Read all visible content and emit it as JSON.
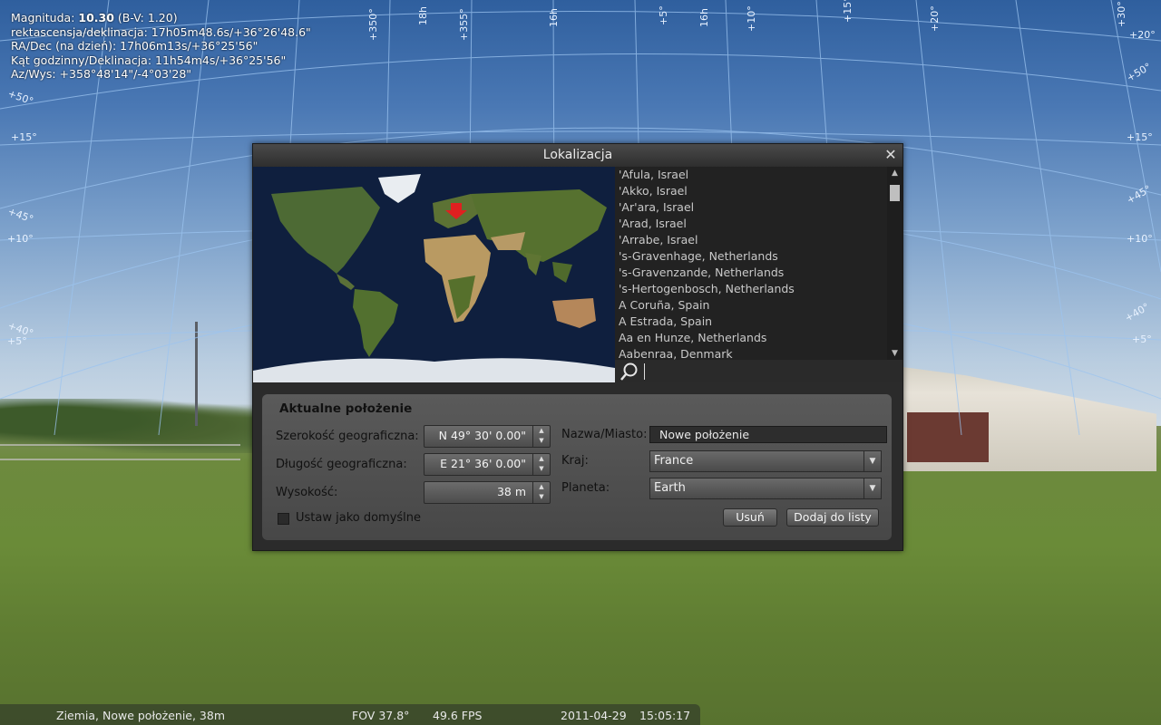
{
  "info": {
    "line1_prefix": "Magnituda:",
    "line1_value": "10.30",
    "line1_suffix": "(B-V: 1.20)",
    "line2": "rektascensja/deklinacja: 17h05m48.6s/+36°26'48.6\"",
    "line3": "RA/Dec (na dzień): 17h06m13s/+36°25'56\"",
    "line4": "Kąt godzinny/Deklinacja: 11h54m4s/+36°25'56\"",
    "line5": "Az/Wys: +358°48'14\"/-4°03'28\""
  },
  "grid_labels": {
    "top": [
      "+350°",
      "18h",
      "+355°",
      "16h",
      "+5°",
      "16h",
      "+10°",
      "+15°",
      "+20°",
      "+30°",
      "+50°"
    ],
    "left": [
      "+50°",
      "+15°",
      "+45°",
      "+10°",
      "+40°",
      "+5°"
    ],
    "right": [
      "+20°",
      "+50°",
      "+15°",
      "+45°",
      "+10°",
      "+40°",
      "+5°"
    ]
  },
  "dialog": {
    "title": "Lokalizacja",
    "close_icon": "close-icon",
    "locations": [
      "'Afula, Israel",
      "'Akko, Israel",
      "'Ar'ara, Israel",
      "'Arad, Israel",
      "'Arrabe, Israel",
      "'s-Gravenhage, Netherlands",
      "'s-Gravenzande, Netherlands",
      "'s-Hertogenbosch, Netherlands",
      "A Coruña, Spain",
      "A Estrada, Spain",
      "Aa en Hunze, Netherlands",
      "Aabenraa, Denmark"
    ],
    "search_value": "",
    "panel": {
      "title": "Aktualne położenie",
      "latitude_label": "Szerokość geograficzna:",
      "latitude_value": "N 49° 30' 0.00\"",
      "longitude_label": "Długość geograficzna:",
      "longitude_value": "E 21° 36' 0.00\"",
      "altitude_label": "Wysokość:",
      "altitude_value": "38 m",
      "default_label": "Ustaw jako domyślne",
      "name_label": "Nazwa/Miasto:",
      "name_value": "Nowe położenie",
      "country_label": "Kraj:",
      "country_value": "France",
      "planet_label": "Planeta:",
      "planet_value": "Earth",
      "delete_button": "Usuń",
      "add_button": "Dodaj do listy"
    }
  },
  "statusbar": {
    "location": "Ziemia, Nowe położenie, 38m",
    "fov": "FOV 37.8°",
    "fps": "49.6 FPS",
    "date": "2011-04-29",
    "time": "15:05:17"
  },
  "colors": {
    "grid_lines": "#9cc4f0",
    "marker": "#e02020"
  }
}
